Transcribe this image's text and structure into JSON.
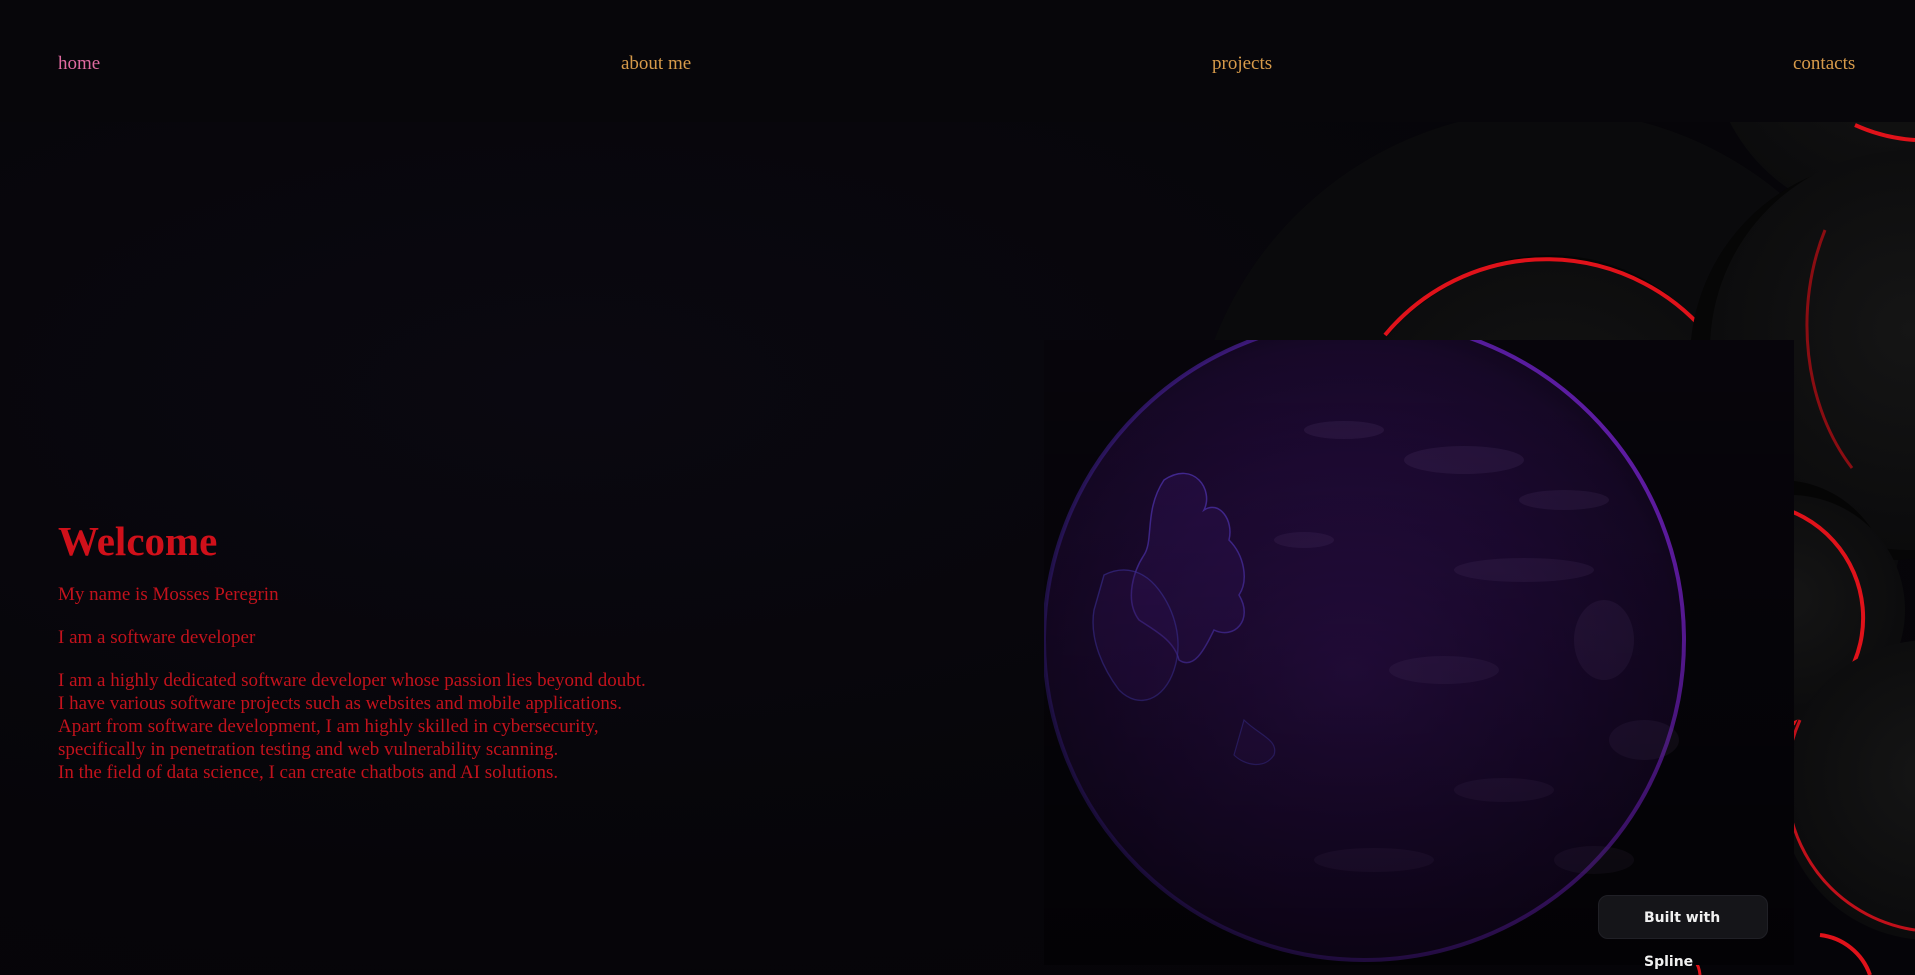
{
  "nav": {
    "items": [
      {
        "label": "home",
        "active": true
      },
      {
        "label": "about me",
        "active": false
      },
      {
        "label": "projects",
        "active": false
      },
      {
        "label": "contacts",
        "active": false
      }
    ]
  },
  "intro": {
    "title": "Welcome",
    "name_line": "My name is Mosses Peregrin",
    "role_line": "I am a software developer",
    "bio_lines": [
      "I am a highly dedicated software developer whose passion lies beyond doubt.",
      "I have various software projects such as websites and mobile applications.",
      "Apart from software development, I am highly skilled in cybersecurity,",
      "specifically in penetration testing and web vulnerability scanning.",
      "In the field of data science, I can create chatbots and AI solutions."
    ]
  },
  "scene": {
    "badge_label": "Built with Spline"
  },
  "colors": {
    "nav_link": "#d79a4a",
    "nav_active": "#e06aa0",
    "intro_text": "#c8141e",
    "ring_accent": "#e0121a",
    "globe_purple": "#5a1fa0",
    "background": "#060509"
  },
  "icons": [
    "globe-graphic",
    "ring-decoration"
  ]
}
